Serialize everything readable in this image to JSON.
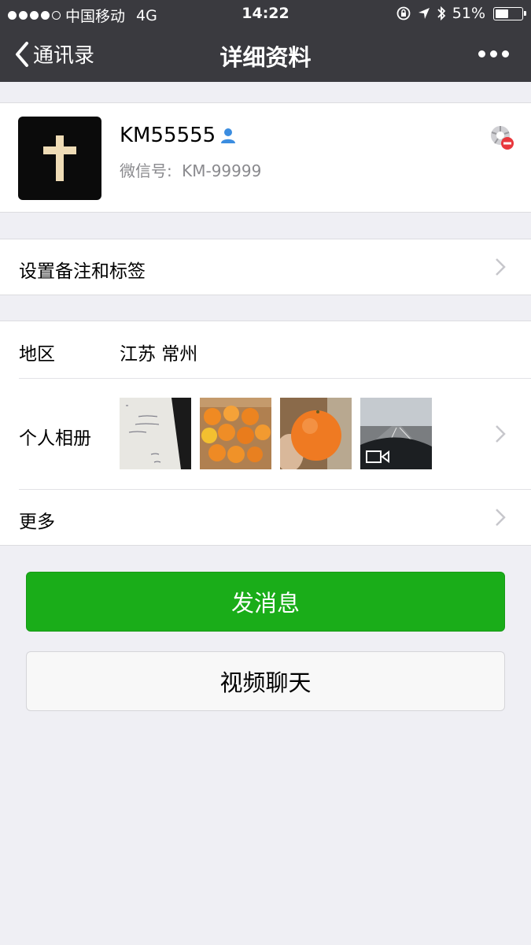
{
  "status_bar": {
    "carrier": "中国移动",
    "network": "4G",
    "time": "14:22",
    "battery": "51%",
    "battery_level": 0.51
  },
  "nav": {
    "back_label": "通讯录",
    "title": "详细资料",
    "more_icon": "ellipsis-icon"
  },
  "profile": {
    "nickname": "KM55555",
    "wechat_id_label": "微信号:",
    "wechat_id": "KM-99999"
  },
  "cells": {
    "remarks_label": "设置备注和标签",
    "region_label": "地区",
    "region_value": "江苏 常州",
    "album_label": "个人相册",
    "more_label": "更多"
  },
  "buttons": {
    "send_message": "发消息",
    "video_chat": "视频聊天"
  },
  "colors": {
    "nav_bg": "#3a3a3f",
    "primary_green": "#1aad19",
    "page_bg": "#efeff4"
  }
}
